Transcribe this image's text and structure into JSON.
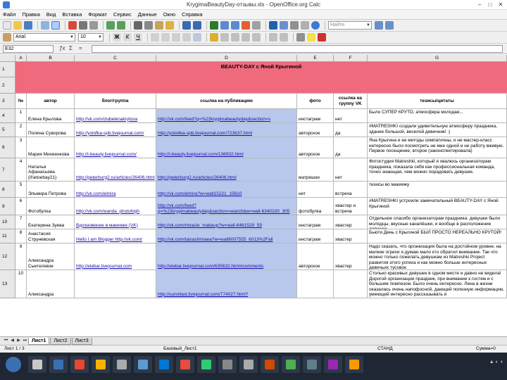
{
  "window": {
    "title": "KrygimaBeautyDay-отзывы.xls - OpenOffice.org Calc"
  },
  "menu": [
    "Файл",
    "Правка",
    "Вид",
    "Вставка",
    "Формат",
    "Сервис",
    "Данные",
    "Окно",
    "Справка"
  ],
  "toolbar": {
    "font_name": "Arial",
    "font_size": "10",
    "search_placeholder": "Найти"
  },
  "formula_bar": {
    "name_box": "E32",
    "fx_label": "ƒx",
    "sum_label": "Σ",
    "eq_label": "="
  },
  "columns": [
    "A",
    "B",
    "C",
    "D",
    "E",
    "F",
    "G"
  ],
  "banner": {
    "title": "BEAUTY-DAY с Яной Крыгиной"
  },
  "table_header": {
    "num": "№",
    "author": "автор",
    "blog": "блог/группа",
    "link": "ссылка на публикацию",
    "photo": "фото",
    "group_link": "ссылка на группу VK",
    "quotes": "тезисы/цитаты"
  },
  "rows": [
    {
      "row": "4",
      "n": "1",
      "author": "Елена Крылова",
      "blog": "http://vk.com/clubelenakrylova",
      "link": "http://vk.com/feed?q=%23krygimabeautyday&section=s",
      "photo": "инстаграм",
      "group": "нет",
      "quote": "Было СУПЕР КРУТО, атмосфера молодая..."
    },
    {
      "row": "5",
      "n": "2",
      "author": "Полина Суворова",
      "blog": "http://yolofka-spb.livejournal.com/",
      "link": "http://yolo4ka-spb.livejournal.com/723637.html",
      "photo": "авторское",
      "group": "да",
      "quote": "#MATRESHKI создали удивительную атмосферу праздника, здание большой, веселой девичник! :)"
    },
    {
      "row": "6",
      "n": "3",
      "author": "Мария Михеенкова",
      "blog": "http://i-beauty.livejournal.com/",
      "link": "http://i-beauty.livejournal.com/136932.html",
      "photo": "авторское",
      "group": "да",
      "quote": "Яна Крыгина и ее методы симпатичны, и не мастер-класс интересно было посмотреть не мне одной и не работу вживую. Первое посещение, второе (законспектировала)"
    },
    {
      "row": "7",
      "n": "4",
      "author": "Наталья Афанасьева (il'ietoebay21)",
      "blog": "http://peterburg2.ru/articles/26406.html",
      "link": "http://peterburg2.ru/articles/26406.html",
      "photo": "матрешки",
      "group": "нет",
      "quote": "Фотостудия Matreshki, который я хвалюсь организаторам праздника, показала себя как профессиональная команда, точно знающая, чем можно порадовать девушек."
    },
    {
      "row": "8",
      "n": "5",
      "author": "Эльмира Петрова",
      "blog": "http://vk.com/elmira",
      "link": "http://vk.com/elmira?w=wall15221_15610",
      "photo": "нет",
      "group": "встреча",
      "quote": "тезисы во макияжу"
    },
    {
      "row": "9",
      "n": "6",
      "author": "Фотобулка",
      "blog": "http://vk.com/wanda_photohigh",
      "link": "http://vk.com/feed?q=%23krygimabeautyday&section=search&w=wall-6340100_305",
      "photo": "фотобулка",
      "group": "хвастер и встреча",
      "quote": "#MATRESHKI устроили замечательный BEAUTY-DAY с Яной Крыгиной"
    },
    {
      "row": "10",
      "n": "7",
      "author": "Екатерина Зуева",
      "blog": "Вдохновение в макияже (VK)",
      "link": "http://vk.com/miracle_makeup?w=wall-6461529_59",
      "photo": "инстаграм",
      "group": "хвастер",
      "quote": "Отдельное спасибо организаторам праздника: девушки были молодцы, вкусные канапёшки, и вообще в расположение девушек"
    },
    {
      "row": "11",
      "n": "8",
      "author": "Анастасия Струневская",
      "blog": "Hello I am Blogger http://vk.com/",
      "link": "http://vk.com/taisashimaea?w=wall8007555_6013%2Fall",
      "photo": "инстаграм",
      "group": "хвастер",
      "quote": "Бьюти День с Крыгиной БЫЛ ПРОСТО НЕРЕАЛЬНО КРУТОЙ!"
    },
    {
      "row": "12",
      "n": "9",
      "author": "Александра Сыктелевзе",
      "blog": "http://elebar.livejournal.com",
      "link": "http://elebar.livejournal.com/635632.html#comments",
      "photo": "авторское",
      "group": "хвастер",
      "quote": "Надо сказать, что организация была на достойном уровне, на мелкие огрехи я думаю мало кто обратил внимание. Так что можно только пожелать девушкам из Matreshki Project развития этого успеха и как можно больше интересных девичьих тусовок"
    },
    {
      "row": "13",
      "n": "10",
      "author": "Александра",
      "blog": "",
      "link": "http://sunnilast.livejournal.com/774027.html?",
      "photo": "",
      "group": "",
      "quote": "Столько красивых девушек в одном месте и давно не видела! Дорогой организации праздник, при внимании к гостям и с большим помпезом. Было очень интересно. Лена в жизни оказалась очень напофосной, дающей полезную информацию, умеющей интересно рассказывать и"
    }
  ],
  "sheet_tabs": [
    "Лист1",
    "Лист2",
    "Лист3"
  ],
  "status": {
    "sheet": "Лист 1 / 3",
    "style": "Базовый_Лист1",
    "mode": "СТАНД",
    "sum": "Сумма=0"
  },
  "taskbar": {
    "icon_colors": [
      "#c8c8c8",
      "#3b6fb3",
      "#e8462f",
      "#f7b500",
      "#aaa",
      "#5b9bd5",
      "#0078d7",
      "#e74c3c",
      "#2ecc71",
      "#888",
      "#aaa",
      "#d04a02",
      "#4caf50",
      "#607d8b",
      "#9c27b0",
      "#ff9800"
    ]
  }
}
